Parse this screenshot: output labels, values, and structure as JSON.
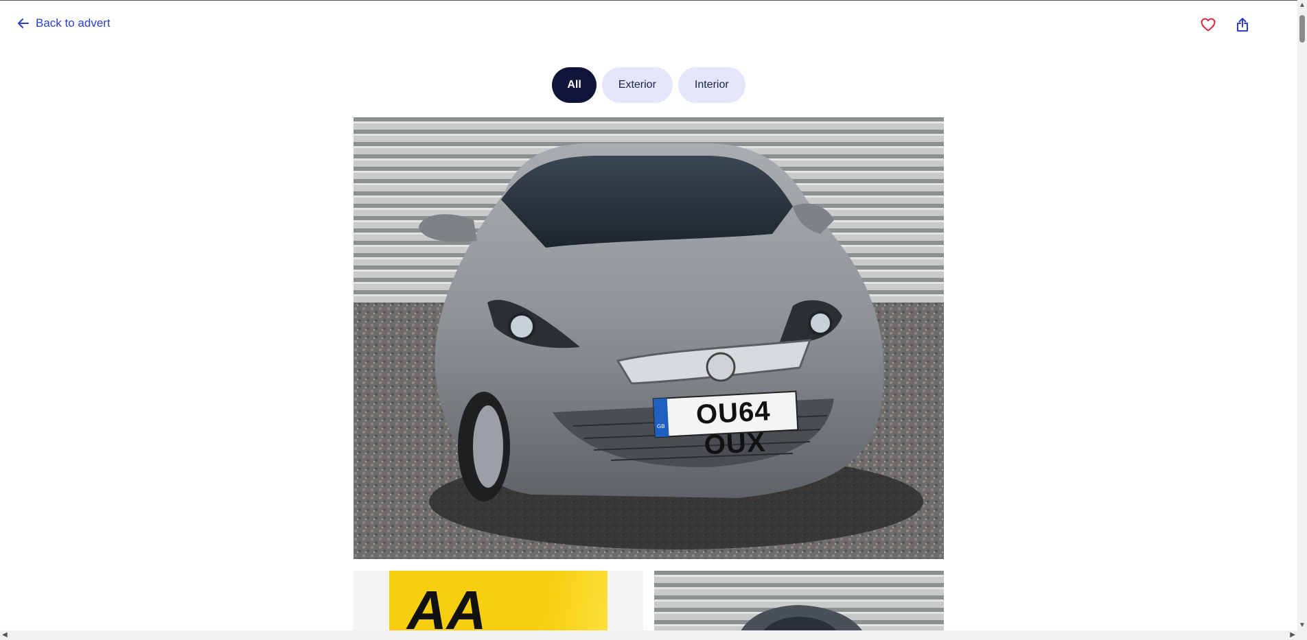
{
  "header": {
    "back_label": "Back to advert"
  },
  "tabs": [
    {
      "label": "All",
      "active": true
    },
    {
      "label": "Exterior",
      "active": false
    },
    {
      "label": "Interior",
      "active": false
    }
  ],
  "photo": {
    "plate": "OU64 OUX",
    "plate_badge": "GB"
  },
  "thumb_left": {
    "brand": "AA"
  },
  "colors": {
    "accent": "#2a3ec8",
    "heart": "#e0263a",
    "tab_active": "#0f1438",
    "tab_inactive": "#e4e6fb"
  }
}
